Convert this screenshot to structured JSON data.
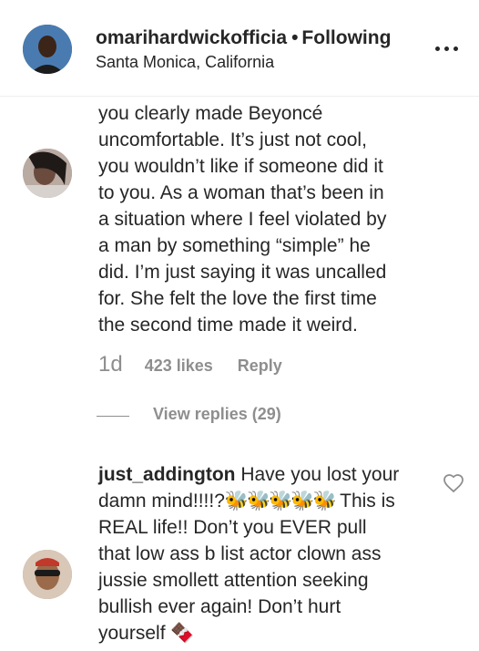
{
  "header": {
    "username": "omarihardwickofficia",
    "separator": "•",
    "follow_status": "Following",
    "location": "Santa Monica, California"
  },
  "comment1": {
    "lines": [
      "you clearly made Beyoncé",
      "uncomfortable. It’s just not cool,",
      "you wouldn’t like if someone did it",
      "to you. As a woman that’s been in",
      "a situation where I feel violated by",
      "a man by something “simple” he",
      "did. I’m just saying it was uncalled",
      "for. She felt the love the first time",
      "the second time made it weird."
    ],
    "time": "1d",
    "likes": "423 likes",
    "reply": "Reply",
    "view_replies": "View replies (29)"
  },
  "comment2": {
    "username": "just_addington",
    "line1_rest": " Have you lost your",
    "line2_pre": "damn mind!!!!?",
    "bees": "🐝🐝🐝🐝🐝",
    "line2_post": " This is",
    "lines": [
      "REAL life!! Don’t you EVER pull",
      "that low ass b list actor clown ass",
      "jussie smollett attention seeking",
      "bullish ever again! Don’t hurt"
    ],
    "last_line": "yourself ",
    "emoji": "🍫"
  }
}
